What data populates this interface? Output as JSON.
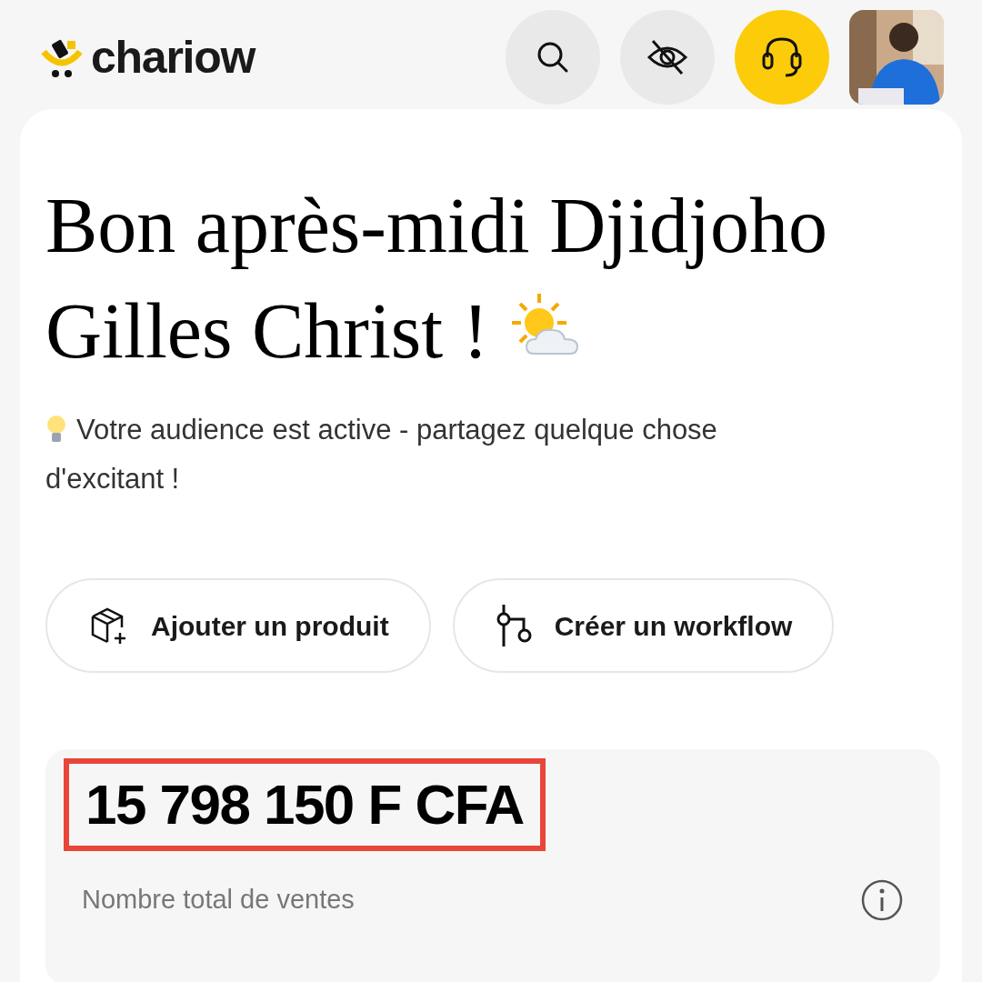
{
  "header": {
    "logo": "chariow",
    "icon_buttons": [
      {
        "kind": "search",
        "highlighted": false
      },
      {
        "kind": "hide",
        "highlighted": false
      },
      {
        "kind": "support",
        "highlighted": true
      }
    ]
  },
  "greeting": {
    "title": "Bon après-midi Djidjoho Gilles Christ !",
    "tip": "Votre audience est active - partagez quelque chose d'excitant !"
  },
  "actions": [
    {
      "kind": "product",
      "label": "Ajouter un produit"
    },
    {
      "kind": "workflow",
      "label": "Créer un workflow"
    }
  ],
  "stats": {
    "value": "15 798 150 F CFA",
    "label": "Nombre total de ventes",
    "highlighted": true
  }
}
